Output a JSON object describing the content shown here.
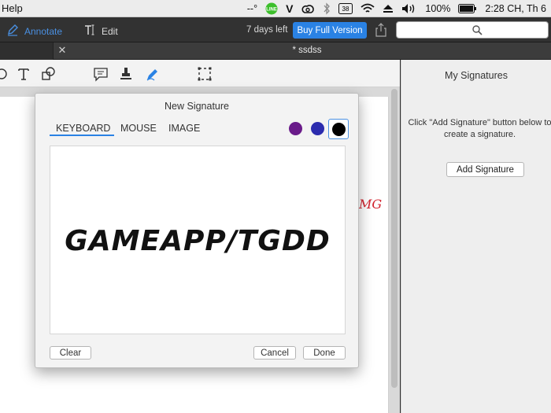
{
  "menubar": {
    "help_label": "Help",
    "status": {
      "indicator": "--°",
      "battery_pct": "100%",
      "clock": "2:28 CH, Th 6",
      "icons": [
        "line-icon",
        "v-icon",
        "creative-cloud-icon",
        "bluetooth-icon",
        "keyboard-input-icon",
        "wifi-icon",
        "eject-icon",
        "volume-icon",
        "battery-icon"
      ]
    }
  },
  "toolbar": {
    "annotate_label": "Annotate",
    "edit_label": "Edit",
    "trial_text": "7 days left",
    "buy_label": "Buy Full Version",
    "search_value": ""
  },
  "tabs": {
    "active_title": "* ssdss"
  },
  "annotation_tools": [
    "move-icon",
    "text-icon",
    "shapes-icon",
    "note-icon",
    "stamp-icon",
    "signature-pen-icon",
    "crop-selection-icon"
  ],
  "document": {
    "visible_fragment": "MG"
  },
  "right_panel": {
    "title": "My Signatures",
    "hint": "Click \"Add Signature\" button below to create a signature.",
    "add_button": "Add Signature"
  },
  "dialog": {
    "title": "New Signature",
    "tabs": [
      "KEYBOARD",
      "MOUSE",
      "IMAGE"
    ],
    "active_tab": "KEYBOARD",
    "colors": [
      "#6a1b8a",
      "#2c2cae",
      "#000000"
    ],
    "selected_color": "#000000",
    "signature_text": "GAMEAPP/TGDD",
    "clear_button": "Clear",
    "cancel_button": "Cancel",
    "done_button": "Done"
  }
}
